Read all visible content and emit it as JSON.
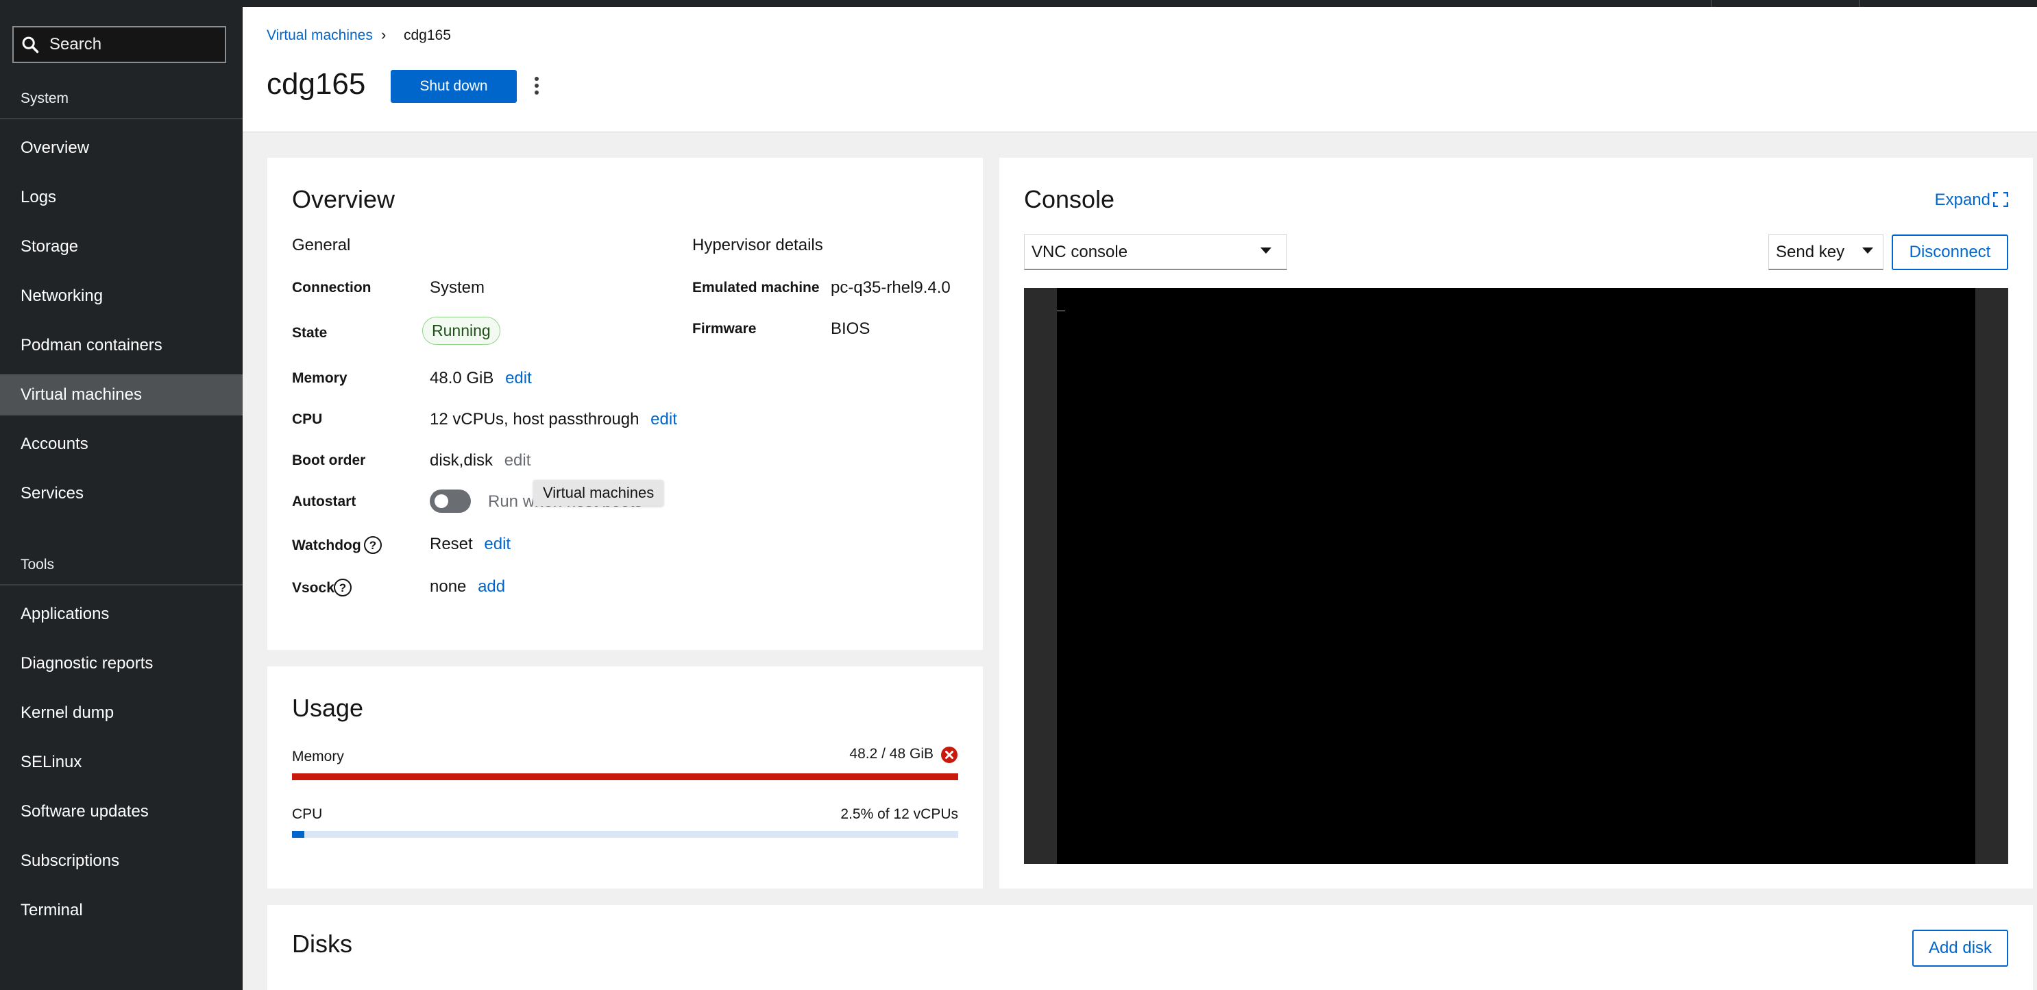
{
  "sidebar": {
    "search_placeholder": "Search",
    "section_system": "System",
    "system_items": [
      {
        "label": "Overview"
      },
      {
        "label": "Logs"
      },
      {
        "label": "Storage"
      },
      {
        "label": "Networking"
      },
      {
        "label": "Podman containers"
      },
      {
        "label": "Virtual machines",
        "active": true
      },
      {
        "label": "Accounts"
      },
      {
        "label": "Services"
      }
    ],
    "section_tools": "Tools",
    "tools_items": [
      {
        "label": "Applications"
      },
      {
        "label": "Diagnostic reports"
      },
      {
        "label": "Kernel dump"
      },
      {
        "label": "SELinux"
      },
      {
        "label": "Software updates"
      },
      {
        "label": "Subscriptions"
      },
      {
        "label": "Terminal"
      }
    ]
  },
  "header": {
    "breadcrumb_parent": "Virtual machines",
    "breadcrumb_separator": "›",
    "breadcrumb_current": "cdg165",
    "title": "cdg165",
    "shutdown_label": "Shut down"
  },
  "overview": {
    "title": "Overview",
    "general_heading": "General",
    "hypervisor_heading": "Hypervisor details",
    "connection_label": "Connection",
    "connection_value": "System",
    "state_label": "State",
    "state_value": "Running",
    "memory_label": "Memory",
    "memory_value": "48.0 GiB",
    "memory_edit": "edit",
    "cpu_label": "CPU",
    "cpu_value": "12 vCPUs, host passthrough",
    "cpu_edit": "edit",
    "boot_label": "Boot order",
    "boot_value": "disk,disk",
    "boot_edit": "edit",
    "autostart_label": "Autostart",
    "autostart_text": "Run when host boots",
    "autostart_enabled": false,
    "watchdog_label": "Watchdog",
    "watchdog_value": "Reset",
    "watchdog_edit": "edit",
    "vsock_label": "Vsock",
    "vsock_value": "none",
    "vsock_add": "add",
    "emulated_label": "Emulated machine",
    "emulated_value": "pc-q35-rhel9.4.0",
    "firmware_label": "Firmware",
    "firmware_value": "BIOS",
    "tooltip": "Virtual machines"
  },
  "usage": {
    "title": "Usage",
    "memory_label": "Memory",
    "memory_value": "48.2 / 48 GiB",
    "memory_fraction": 1.0,
    "memory_color": "#c9190b",
    "cpu_label": "CPU",
    "cpu_value": "2.5% of 12 vCPUs",
    "cpu_fraction": 0.025,
    "cpu_color": "#0066cc"
  },
  "console": {
    "title": "Console",
    "expand_label": "Expand",
    "type_selected": "VNC console",
    "send_key_label": "Send key",
    "disconnect_label": "Disconnect",
    "cursor": "_"
  },
  "disks": {
    "title": "Disks",
    "add_disk_label": "Add disk"
  },
  "colors": {
    "accent": "#0066cc",
    "sidebar_bg": "#212427",
    "danger": "#c9190b"
  }
}
